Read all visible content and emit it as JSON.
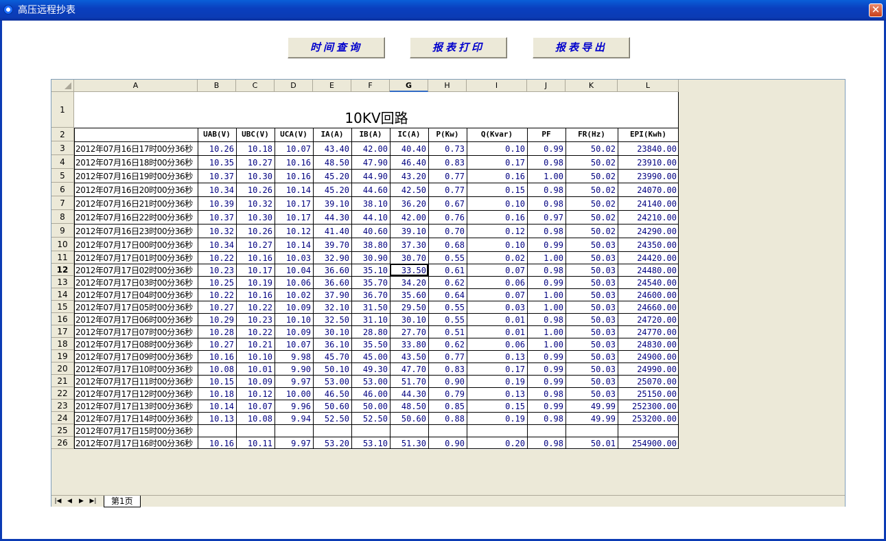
{
  "window": {
    "title": "高压远程抄表",
    "close_label": "✕"
  },
  "toolbar": {
    "query_label": "时间查询",
    "print_label": "报表打印",
    "export_label": "报表导出"
  },
  "sheet": {
    "columns": [
      "A",
      "B",
      "C",
      "D",
      "E",
      "F",
      "G",
      "H",
      "I",
      "J",
      "K",
      "L"
    ],
    "selected_column": "G",
    "selected_row": 12,
    "table_title": "10KV回路",
    "headers": [
      "",
      "UAB(V)",
      "UBC(V)",
      "UCA(V)",
      "IA(A)",
      "IB(A)",
      "IC(A)",
      "P(Kw)",
      "Q(Kvar)",
      "PF",
      "FR(Hz)",
      "EPI(Kwh)"
    ],
    "rows": [
      [
        "2012年07月16日17时00分36秒",
        "10.26",
        "10.18",
        "10.07",
        "43.40",
        "42.00",
        "40.40",
        "0.73",
        "0.10",
        "0.99",
        "50.02",
        "23840.00"
      ],
      [
        "2012年07月16日18时00分36秒",
        "10.35",
        "10.27",
        "10.16",
        "48.50",
        "47.90",
        "46.40",
        "0.83",
        "0.17",
        "0.98",
        "50.02",
        "23910.00"
      ],
      [
        "2012年07月16日19时00分36秒",
        "10.37",
        "10.30",
        "10.16",
        "45.20",
        "44.90",
        "43.20",
        "0.77",
        "0.16",
        "1.00",
        "50.02",
        "23990.00"
      ],
      [
        "2012年07月16日20时00分36秒",
        "10.34",
        "10.26",
        "10.14",
        "45.20",
        "44.60",
        "42.50",
        "0.77",
        "0.15",
        "0.98",
        "50.02",
        "24070.00"
      ],
      [
        "2012年07月16日21时00分36秒",
        "10.39",
        "10.32",
        "10.17",
        "39.10",
        "38.10",
        "36.20",
        "0.67",
        "0.10",
        "0.98",
        "50.02",
        "24140.00"
      ],
      [
        "2012年07月16日22时00分36秒",
        "10.37",
        "10.30",
        "10.17",
        "44.30",
        "44.10",
        "42.00",
        "0.76",
        "0.16",
        "0.97",
        "50.02",
        "24210.00"
      ],
      [
        "2012年07月16日23时00分36秒",
        "10.32",
        "10.26",
        "10.12",
        "41.40",
        "40.60",
        "39.10",
        "0.70",
        "0.12",
        "0.98",
        "50.02",
        "24290.00"
      ],
      [
        "2012年07月17日00时00分36秒",
        "10.34",
        "10.27",
        "10.14",
        "39.70",
        "38.80",
        "37.30",
        "0.68",
        "0.10",
        "0.99",
        "50.03",
        "24350.00"
      ],
      [
        "2012年07月17日01时00分36秒",
        "10.22",
        "10.16",
        "10.03",
        "32.90",
        "30.90",
        "30.70",
        "0.55",
        "0.02",
        "1.00",
        "50.03",
        "24420.00"
      ],
      [
        "2012年07月17日02时00分36秒",
        "10.23",
        "10.17",
        "10.04",
        "36.60",
        "35.10",
        "33.50",
        "0.61",
        "0.07",
        "0.98",
        "50.03",
        "24480.00"
      ],
      [
        "2012年07月17日03时00分36秒",
        "10.25",
        "10.19",
        "10.06",
        "36.60",
        "35.70",
        "34.20",
        "0.62",
        "0.06",
        "0.99",
        "50.03",
        "24540.00"
      ],
      [
        "2012年07月17日04时00分36秒",
        "10.22",
        "10.16",
        "10.02",
        "37.90",
        "36.70",
        "35.60",
        "0.64",
        "0.07",
        "1.00",
        "50.03",
        "24600.00"
      ],
      [
        "2012年07月17日05时00分36秒",
        "10.27",
        "10.22",
        "10.09",
        "32.10",
        "31.50",
        "29.50",
        "0.55",
        "0.03",
        "1.00",
        "50.03",
        "24660.00"
      ],
      [
        "2012年07月17日06时00分36秒",
        "10.29",
        "10.23",
        "10.10",
        "32.50",
        "31.10",
        "30.10",
        "0.55",
        "0.01",
        "0.98",
        "50.03",
        "24720.00"
      ],
      [
        "2012年07月17日07时00分36秒",
        "10.28",
        "10.22",
        "10.09",
        "30.10",
        "28.80",
        "27.70",
        "0.51",
        "0.01",
        "1.00",
        "50.03",
        "24770.00"
      ],
      [
        "2012年07月17日08时00分36秒",
        "10.27",
        "10.21",
        "10.07",
        "36.10",
        "35.50",
        "33.80",
        "0.62",
        "0.06",
        "1.00",
        "50.03",
        "24830.00"
      ],
      [
        "2012年07月17日09时00分36秒",
        "10.16",
        "10.10",
        "9.98",
        "45.70",
        "45.00",
        "43.50",
        "0.77",
        "0.13",
        "0.99",
        "50.03",
        "24900.00"
      ],
      [
        "2012年07月17日10时00分36秒",
        "10.08",
        "10.01",
        "9.90",
        "50.10",
        "49.30",
        "47.70",
        "0.83",
        "0.17",
        "0.99",
        "50.03",
        "24990.00"
      ],
      [
        "2012年07月17日11时00分36秒",
        "10.15",
        "10.09",
        "9.97",
        "53.00",
        "53.00",
        "51.70",
        "0.90",
        "0.19",
        "0.99",
        "50.03",
        "25070.00"
      ],
      [
        "2012年07月17日12时00分36秒",
        "10.18",
        "10.12",
        "10.00",
        "46.50",
        "46.00",
        "44.30",
        "0.79",
        "0.13",
        "0.98",
        "50.03",
        "25150.00"
      ],
      [
        "2012年07月17日13时00分36秒",
        "10.14",
        "10.07",
        "9.96",
        "50.60",
        "50.00",
        "48.50",
        "0.85",
        "0.15",
        "0.99",
        "49.99",
        "252300.00"
      ],
      [
        "2012年07月17日14时00分36秒",
        "10.13",
        "10.08",
        "9.94",
        "52.50",
        "52.50",
        "50.60",
        "0.88",
        "0.19",
        "0.98",
        "49.99",
        "253200.00"
      ],
      [
        "2012年07月17日15时00分36秒",
        "",
        "",
        "",
        "",
        "",
        "",
        "",
        "",
        "",
        "",
        ""
      ],
      [
        "2012年07月17日16时00分36秒",
        "10.16",
        "10.11",
        "9.97",
        "53.20",
        "53.10",
        "51.30",
        "0.90",
        "0.20",
        "0.98",
        "50.01",
        "254900.00"
      ]
    ],
    "sheet_tab": "第1页",
    "nav": [
      "|◀",
      "◀",
      "▶",
      "▶|"
    ]
  },
  "colors": {
    "titlebar": "#0b3bb4",
    "cell_text": "#000080",
    "sheet_bg": "#ece9d8"
  }
}
